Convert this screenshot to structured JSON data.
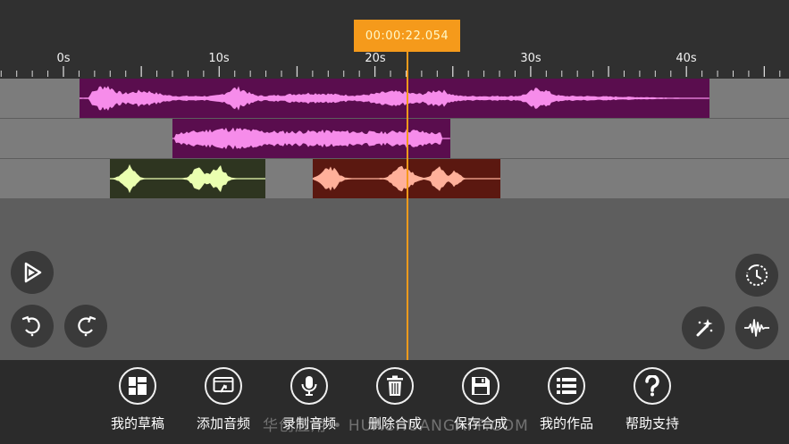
{
  "playhead": {
    "timecode": "00:00:22.054"
  },
  "ruler": {
    "labels": [
      "0s",
      "10s",
      "20s",
      "30s",
      "40s"
    ]
  },
  "colors": {
    "accent": "#f59a1b",
    "track1_bg": "#5a0d4e",
    "track1_wave": "#f68cea",
    "track2_bg": "#5a0d4e",
    "track2_wave": "#f68cea",
    "track3a_bg": "#2e3520",
    "track3a_wave": "#eaffb0",
    "track3b_bg": "#5b1810",
    "track3b_wave": "#ffb09a"
  },
  "controls": {
    "play": "play-icon",
    "undo": "undo-icon",
    "redo": "redo-icon",
    "timer": "timer-icon",
    "magic": "magic-wand-icon",
    "waveform": "waveform-icon"
  },
  "toolbar": {
    "items": [
      {
        "label": "我的草稿",
        "icon": "drafts-icon"
      },
      {
        "label": "添加音频",
        "icon": "add-audio-icon"
      },
      {
        "label": "录制音频",
        "icon": "microphone-icon"
      },
      {
        "label": "删除合成",
        "icon": "trash-icon"
      },
      {
        "label": "保存合成",
        "icon": "save-icon"
      },
      {
        "label": "我的作品",
        "icon": "list-icon"
      },
      {
        "label": "帮助支持",
        "icon": "help-icon"
      }
    ]
  },
  "watermark": "华创应用 • HUACHUANGAPP.COM"
}
